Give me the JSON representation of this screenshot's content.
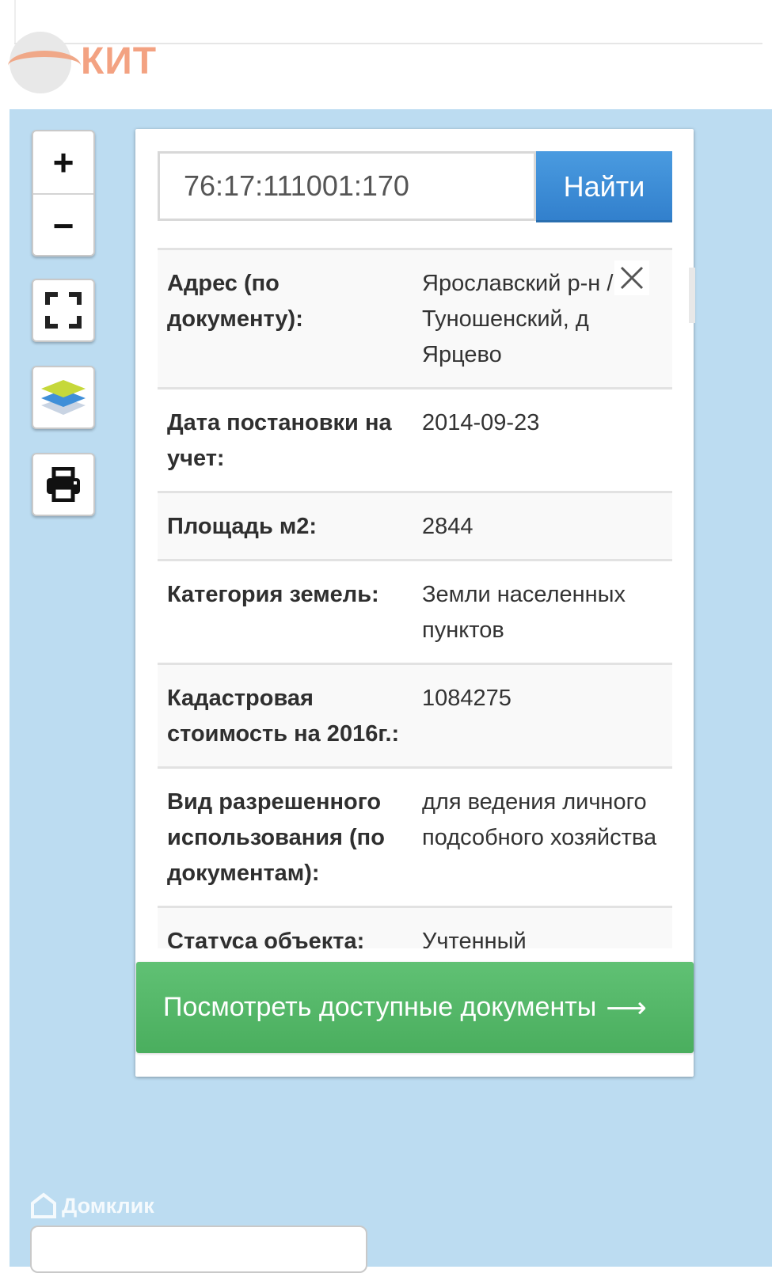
{
  "brand": {
    "name": "КИТ"
  },
  "search": {
    "value": "76:17:111001:170",
    "button_label": "Найти"
  },
  "info_rows": [
    {
      "label": "Адрес (по документу):",
      "value": "Ярославский р-н / о Туношенский, д Ярцево"
    },
    {
      "label": "Дата постановки на учет:",
      "value": "2014-09-23"
    },
    {
      "label": "Площадь м2:",
      "value": "2844"
    },
    {
      "label": "Категория земель:",
      "value": "Земли населенных пунктов"
    },
    {
      "label": "Кадастровая стоимость на 2016г.:",
      "value": "1084275"
    },
    {
      "label": "Вид разрешенного использования (по документам):",
      "value": "для ведения личного подсобного хозяйства"
    },
    {
      "label": "Статуса объекта:",
      "value": "Учтенный"
    }
  ],
  "actions": {
    "docs_label": "Посмотреть доступные документы",
    "docs_arrow": "⟶"
  },
  "map_controls": {
    "zoom_in": "+",
    "zoom_out": "−"
  },
  "watermark": {
    "text": "Домклик"
  },
  "colors": {
    "map_bg": "#bcdcf1",
    "accent_blue": "#3d8fd6",
    "accent_green": "#55b769",
    "brand_orange": "#f3a282"
  }
}
